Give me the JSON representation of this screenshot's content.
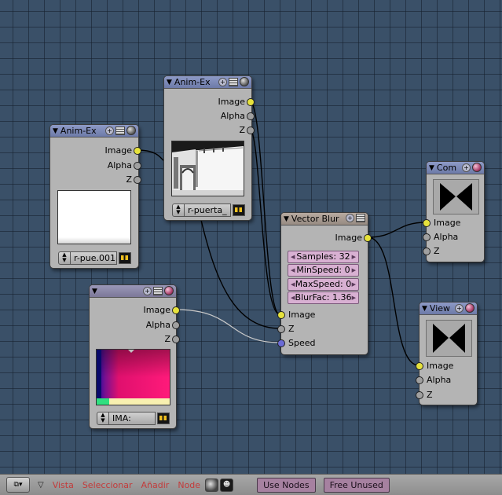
{
  "nodes": {
    "anim_ex_1": {
      "title": "Anim-Ex",
      "outputs": [
        "Image",
        "Alpha",
        "Z"
      ],
      "image_field": "r-pue.001"
    },
    "anim_ex_2": {
      "title": "Anim-Ex",
      "outputs": [
        "Image",
        "Alpha",
        "Z"
      ],
      "image_field": "r-puerta_"
    },
    "image_node": {
      "title": "",
      "outputs": [
        "Image",
        "Alpha",
        "Z"
      ],
      "image_field": "IMA:"
    },
    "vector_blur": {
      "title": "Vector Blur",
      "output": "Image",
      "fields": [
        {
          "label": "Samples: 32"
        },
        {
          "label": "MinSpeed: 0"
        },
        {
          "label": "MaxSpeed: 0"
        },
        {
          "label": "BlurFac: 1.36"
        }
      ],
      "inputs": [
        "Image",
        "Z",
        "Speed"
      ]
    },
    "composite": {
      "title": "Com",
      "inputs": [
        "Image",
        "Alpha",
        "Z"
      ]
    },
    "viewer": {
      "title": "View",
      "inputs": [
        "Image",
        "Alpha",
        "Z"
      ]
    }
  },
  "header_bar": {
    "menus": [
      "Vista",
      "Seleccionar",
      "Añadir",
      "Node"
    ],
    "use_nodes_label": "Use Nodes",
    "free_unused_label": "Free Unused"
  },
  "colors": {
    "background": "#3a5068",
    "socket_image": "#e6e23c",
    "socket_value": "#a0a0a0",
    "socket_vector": "#6b6bd6",
    "menu_text": "#c33c3c",
    "toggle_button": "#a681a0"
  }
}
